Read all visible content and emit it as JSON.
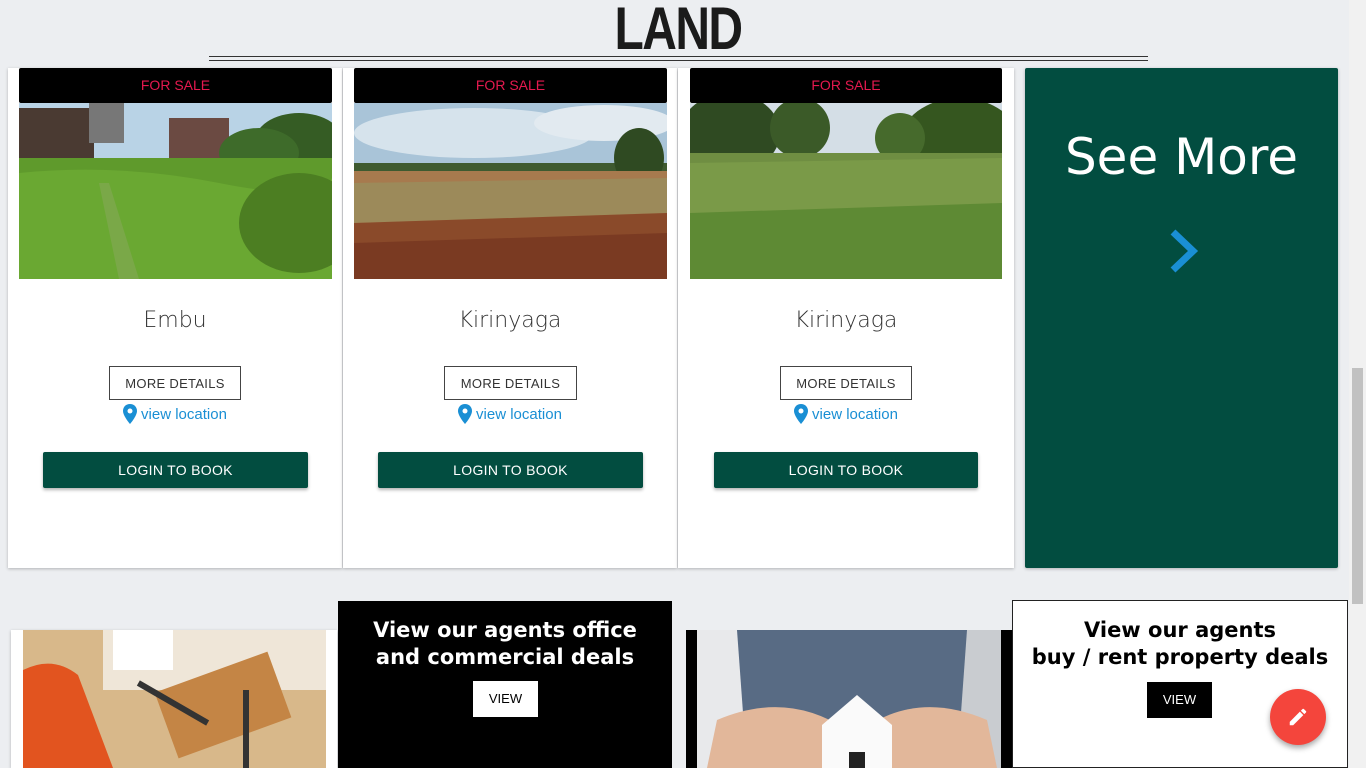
{
  "page": {
    "title": "LAND"
  },
  "listings": [
    {
      "badge": "FOR SALE",
      "place": "Embu",
      "more_label": "MORE DETAILS",
      "location_label": "view location",
      "book_label": "LOGIN TO BOOK"
    },
    {
      "badge": "FOR SALE",
      "place": "Kirinyaga",
      "more_label": "MORE DETAILS",
      "location_label": "view location",
      "book_label": "LOGIN TO BOOK"
    },
    {
      "badge": "FOR SALE",
      "place": "Kirinyaga",
      "more_label": "MORE DETAILS",
      "location_label": "view location",
      "book_label": "LOGIN TO BOOK"
    }
  ],
  "see_more": {
    "label": "See More",
    "icon": "chevron-right-icon"
  },
  "promos": {
    "office": {
      "title": "View our agents office and commercial deals",
      "button": "VIEW"
    },
    "buy_rent": {
      "title_line1": "View our agents",
      "title_line2": "buy / rent property deals",
      "button": "VIEW"
    }
  },
  "fab": {
    "icon": "pencil-icon"
  },
  "colors": {
    "brand_green": "#024d40",
    "sale_red": "#e5194f",
    "link_blue": "#1a8fd4",
    "fab_red": "#f4453c"
  }
}
